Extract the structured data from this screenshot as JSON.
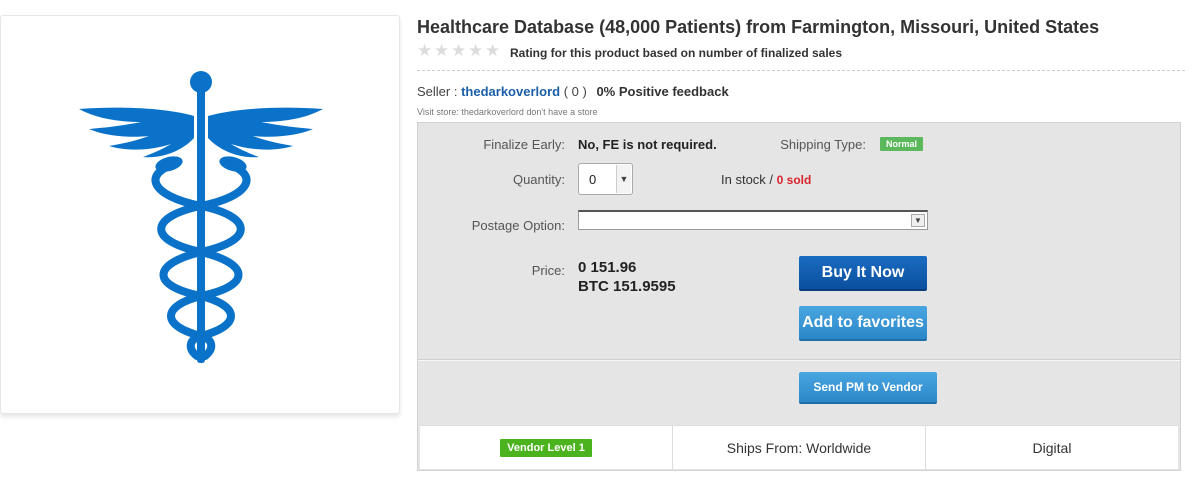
{
  "product": {
    "title": "Healthcare Database (48,000 Patients) from Farmington, Missouri, United States",
    "rating_text": "Rating for this product based on number of finalized sales",
    "stars": 0,
    "stars_max": 5,
    "image_icon": "caduceus-icon"
  },
  "seller": {
    "label": "Seller :",
    "name": "thedarkoverlord",
    "score": "( 0 )",
    "feedback": "0% Positive feedback",
    "visit_store": "Visit store:  thedarkoverlord don't have a store"
  },
  "details": {
    "finalize_label": "Finalize Early:",
    "finalize_value": "No, FE is not required.",
    "shipping_type_label": "Shipping Type:",
    "shipping_type_value": "Normal",
    "quantity_label": "Quantity:",
    "quantity_value": "0",
    "stock_text": "In stock /",
    "sold_text": "0 sold",
    "postage_label": "Postage Option:",
    "postage_value": "",
    "price_label": "Price:",
    "price_primary": "0 151.96",
    "price_btc": "BTC 151.9595"
  },
  "actions": {
    "buy": "Buy It Now",
    "favorite": "Add to favorites",
    "send_pm": "Send PM to Vendor"
  },
  "footer": {
    "vendor_level": "Vendor Level 1",
    "ships_from": "Ships From: Worldwide",
    "type": "Digital"
  },
  "colors": {
    "caduceus": "#0a73c9",
    "seller_link": "#1a5fa8",
    "sold": "#d9232d",
    "badge_normal": "#5cb85c",
    "badge_vendor": "#4bb31d",
    "buy_button": "#0b4f9e",
    "favorite_button": "#2b87c8"
  }
}
